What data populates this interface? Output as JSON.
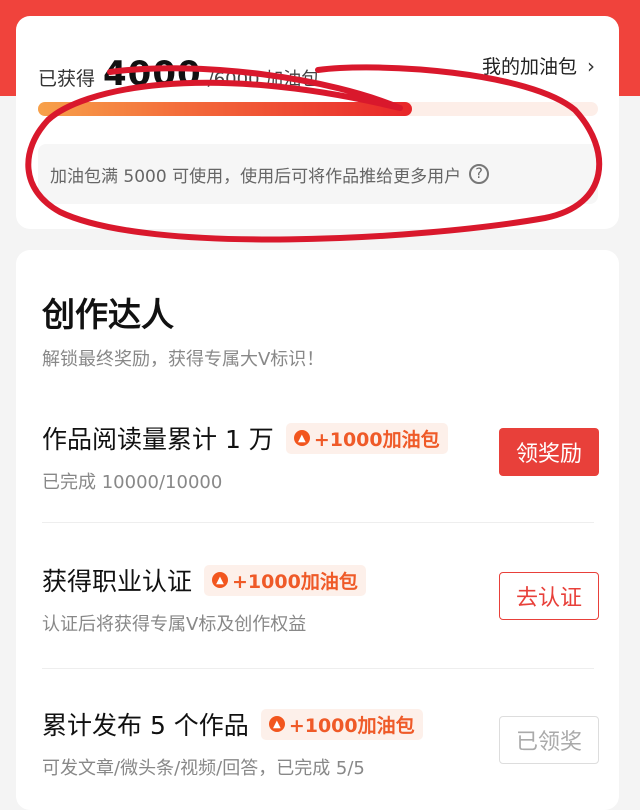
{
  "summary": {
    "earned_label": "已获得",
    "earned_value": "4000",
    "total_label": "/6000 加油包",
    "my_pack_label": "我的加油包",
    "progress_fraction": 0.667,
    "tip_text": "加油包满 5000 可使用，使用后可将作品推给更多用户",
    "help_icon": "question-circle-icon"
  },
  "section": {
    "title": "创作达人",
    "subtitle": "解锁最终奖励，获得专属大V标识！"
  },
  "tasks": [
    {
      "title": "作品阅读量累计 1 万",
      "reward": "+1000加油包",
      "description": "已完成 10000/10000",
      "action_label": "领奖励"
    },
    {
      "title": "获得职业认证",
      "reward": "+1000加油包",
      "description": "认证后将获得专属V标及创作权益",
      "action_label": "去认证"
    },
    {
      "title": "累计发布 5 个作品",
      "reward": "+1000加油包",
      "description": "可发文章/微头条/视频/回答，已完成 5/5",
      "action_label": "已领奖"
    }
  ],
  "colors": {
    "brand_red": "#e8403a",
    "reward_orange": "#ef5a28",
    "scribble_red": "#d9182c"
  }
}
